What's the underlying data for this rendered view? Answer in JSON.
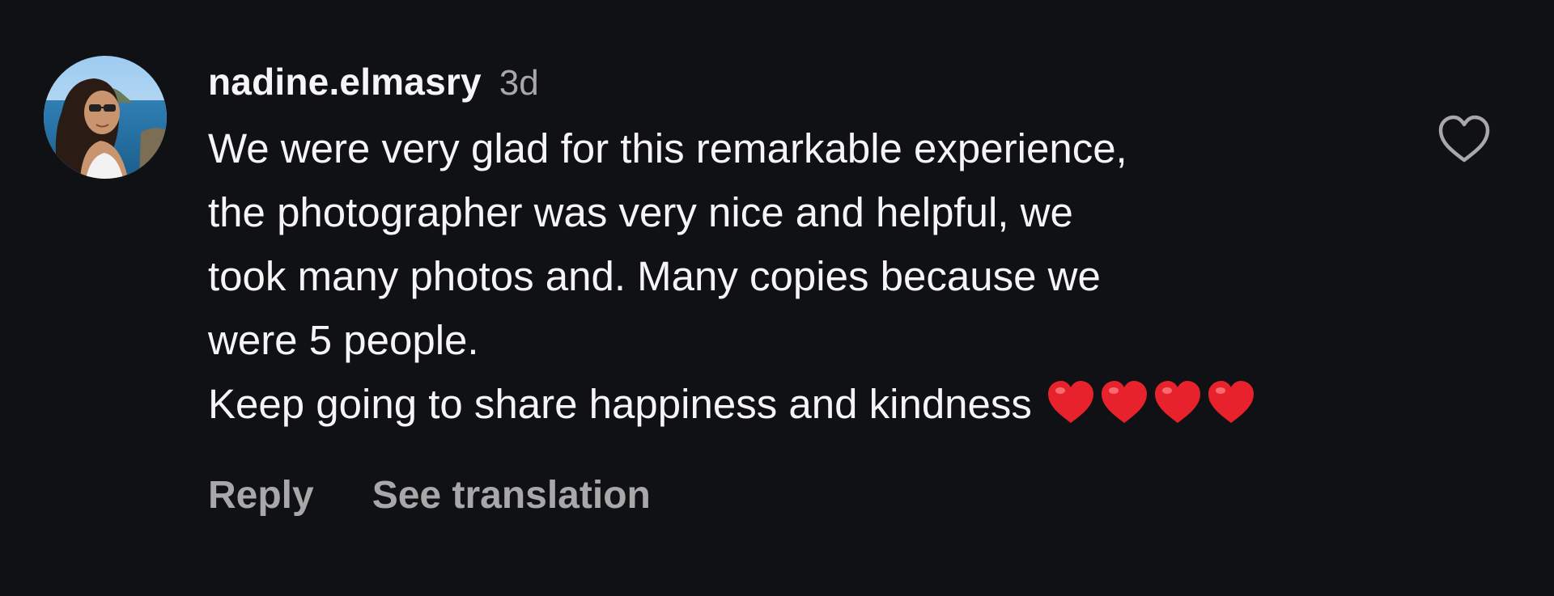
{
  "comment": {
    "username": "nadine.elmasry",
    "time": "3d",
    "lines": [
      "We were very glad for this remarkable experience,",
      "the photographer was very nice and helpful, we",
      "took many photos and. Many copies because we",
      "were 5 people.",
      "Keep going to share happiness and kindness"
    ],
    "emoji": [
      "❤️",
      "❤️",
      "❤️",
      "❤️"
    ],
    "like_icon": "heart-outline-icon"
  },
  "actions": {
    "reply_label": "Reply",
    "translate_label": "See translation"
  },
  "colors": {
    "background": "#101114",
    "text_primary": "#f5f5f5",
    "text_secondary": "#a8a8a8",
    "heart_red": "#e8222c"
  }
}
